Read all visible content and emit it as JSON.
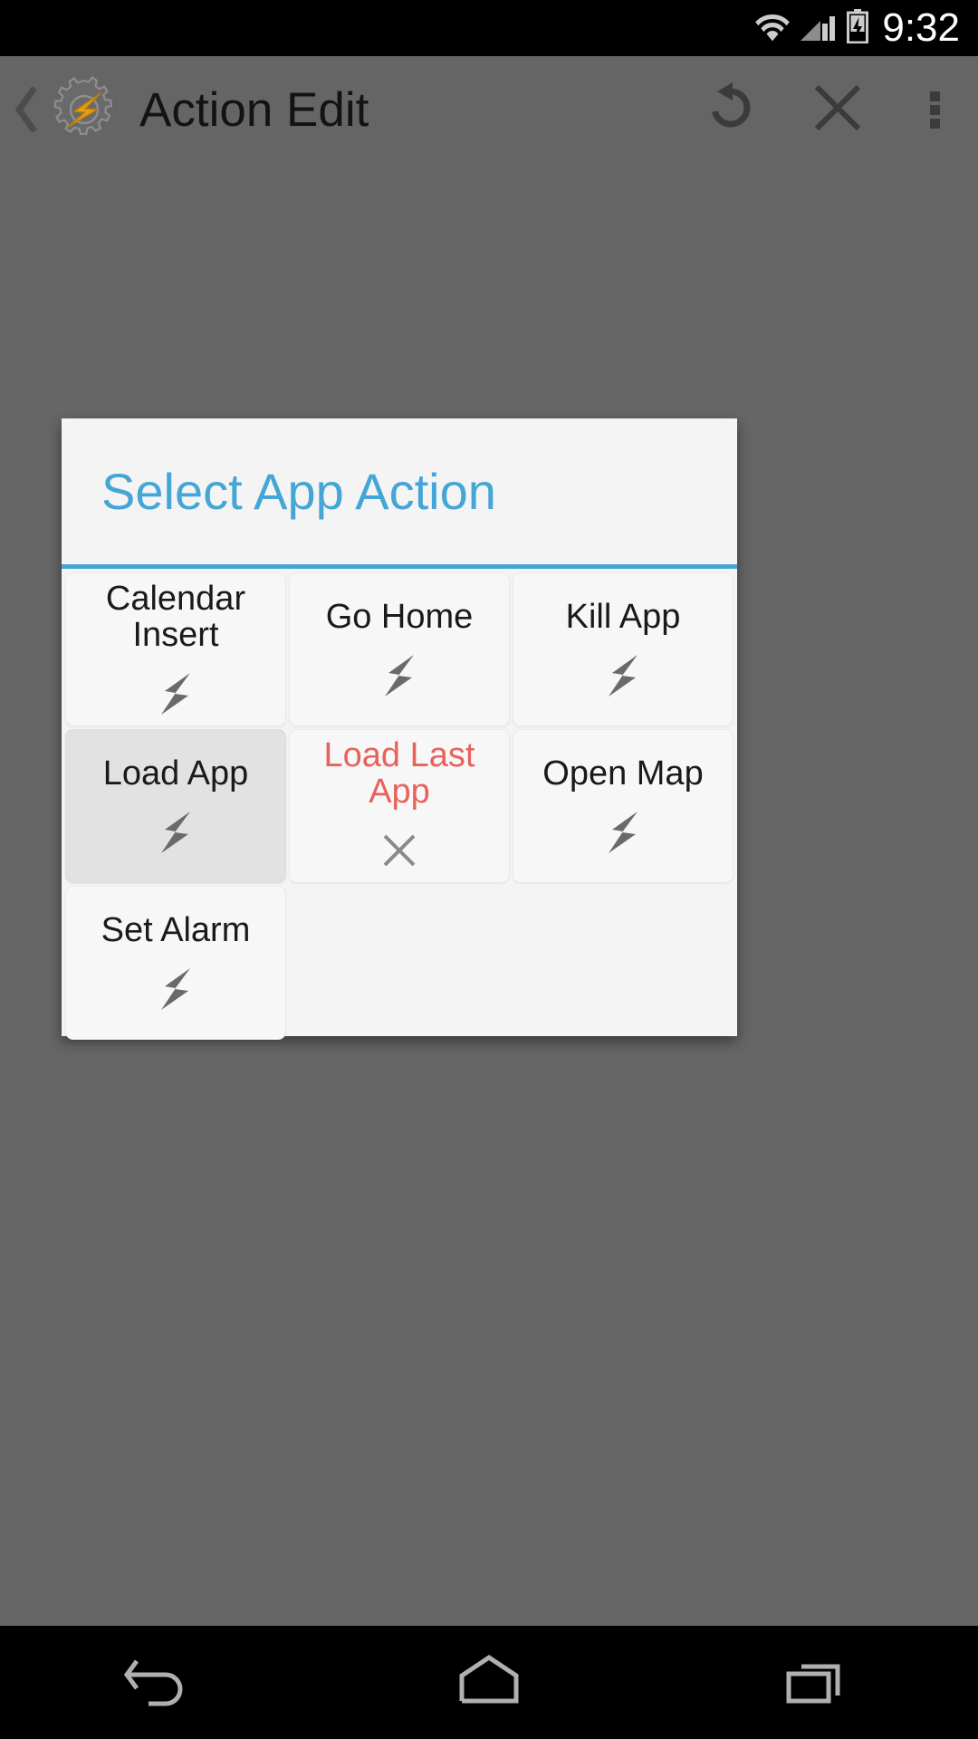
{
  "status_bar": {
    "clock": "9:32",
    "icons": [
      "wifi-icon",
      "cellular-signal-icon",
      "battery-charging-icon"
    ]
  },
  "action_bar": {
    "back_icon": "back-chevron-icon",
    "app_icon": "tasker-gear-bolt-icon",
    "title": "Action Edit",
    "buttons": [
      {
        "name": "undo-button",
        "icon": "undo-rotate-icon"
      },
      {
        "name": "close-button",
        "icon": "close-x-icon"
      },
      {
        "name": "overflow-button",
        "icon": "overflow-dots-icon"
      }
    ]
  },
  "dialog": {
    "title": "Select App Action",
    "accent_color": "#43a6d6",
    "divider_color": "#46a5d4",
    "background_color": "#f4f4f4",
    "warn_color": "#e8625c",
    "selected_background": "#e2e2e2",
    "actions": [
      {
        "label": "Calendar Insert",
        "icon": "lightning-bolt-icon",
        "state": "normal"
      },
      {
        "label": "Go Home",
        "icon": "lightning-bolt-icon",
        "state": "normal"
      },
      {
        "label": "Kill App",
        "icon": "lightning-bolt-icon",
        "state": "normal"
      },
      {
        "label": "Load App",
        "icon": "lightning-bolt-icon",
        "state": "selected"
      },
      {
        "label": "Load Last App",
        "icon": "close-x-icon",
        "state": "unavailable"
      },
      {
        "label": "Open Map",
        "icon": "lightning-bolt-icon",
        "state": "normal"
      },
      {
        "label": "Set Alarm",
        "icon": "lightning-bolt-icon",
        "state": "normal"
      }
    ]
  },
  "nav_bar": {
    "buttons": [
      {
        "name": "nav-back-button",
        "icon": "nav-back-icon"
      },
      {
        "name": "nav-home-button",
        "icon": "nav-home-icon"
      },
      {
        "name": "nav-recents-button",
        "icon": "nav-recents-icon"
      }
    ]
  }
}
